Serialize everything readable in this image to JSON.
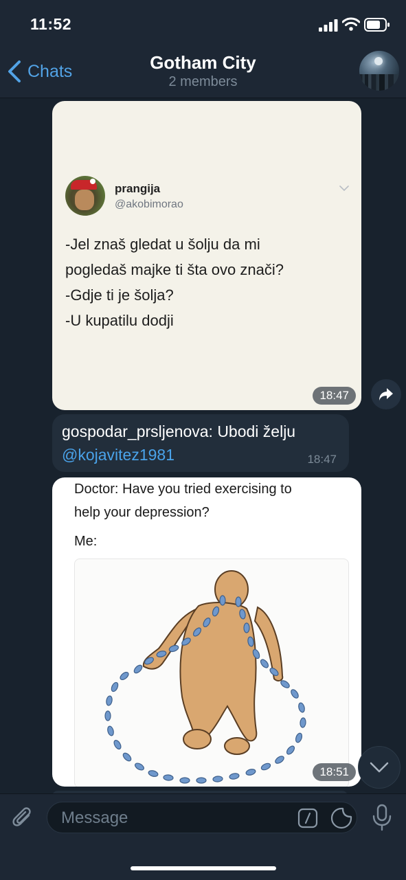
{
  "status_bar": {
    "time": "11:52"
  },
  "header": {
    "back_label": "Chats",
    "title": "Gotham City",
    "subtitle": "2 members"
  },
  "messages": {
    "tweet_image": {
      "author_name": "prangija",
      "author_handle": "@akobimorao",
      "lines": [
        "-Jel znaš gledat u šolju da mi",
        "pogledaš majke ti šta ovo znači?",
        "-Gdje ti je šolja?",
        "-U kupatilu dodji"
      ],
      "time": "18:47"
    },
    "text_message": {
      "text": "gospodar_prsljenova: Ubodi želju",
      "mention": "@kojavitez1981",
      "time": "18:47"
    },
    "meme_image": {
      "lines": [
        "Doctor: Have you tried exercising to",
        "help your depression?",
        "Me:"
      ],
      "time": "18:51"
    }
  },
  "input": {
    "placeholder": "Message"
  },
  "colors": {
    "background": "#18222d",
    "bar": "#1d2734",
    "accent": "#52a3e6",
    "mention": "#4aa3ea",
    "incoming_bubble": "#222e3b"
  }
}
